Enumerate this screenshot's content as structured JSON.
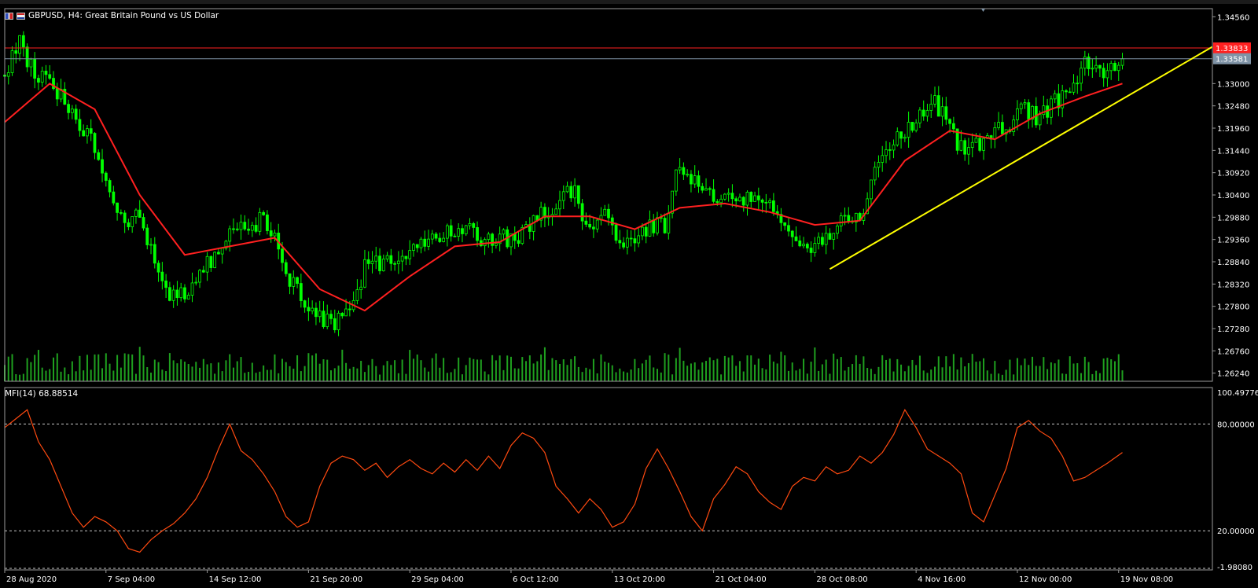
{
  "title": "GBPUSD, H4:  Great Britain Pound vs US Dollar",
  "price_axis": [
    "1.34560",
    "1.33000",
    "1.32480",
    "1.31960",
    "1.31440",
    "1.30920",
    "1.30400",
    "1.29880",
    "1.29360",
    "1.28840",
    "1.28320",
    "1.27800",
    "1.27280",
    "1.26760",
    "1.26240"
  ],
  "price_tags": {
    "red": "1.33833",
    "gray": "1.33581"
  },
  "mfi": {
    "label": "MFI(14) 68.88514",
    "axis": [
      "100.49776",
      "80.00000",
      "20.00000",
      "-1.98080"
    ]
  },
  "time_axis": [
    "28 Aug 2020",
    "7 Sep 04:00",
    "14 Sep 12:00",
    "21 Sep 20:00",
    "29 Sep 04:00",
    "6 Oct 12:00",
    "13 Oct 20:00",
    "21 Oct 04:00",
    "28 Oct 08:00",
    "4 Nov 16:00",
    "12 Nov 00:00",
    "19 Nov 08:00"
  ],
  "colors": {
    "background": "#000000",
    "candles": "#00ff00",
    "volumes": "#1fa01f",
    "ma": "#ff2020",
    "mfi": "#ff4a10",
    "trendline": "#ffff00",
    "red_level": "#ff2020",
    "gray_level": "#7f93a6"
  },
  "chart_data": [
    {
      "type": "candlestick",
      "symbol": "GBPUSD",
      "timeframe": "H4",
      "ylim": [
        1.2605,
        1.3475
      ],
      "close_path": [
        [
          0,
          1.332
        ],
        [
          4,
          1.339
        ],
        [
          8,
          1.333
        ],
        [
          12,
          1.33
        ],
        [
          16,
          1.326
        ],
        [
          20,
          1.321
        ],
        [
          24,
          1.315
        ],
        [
          28,
          1.305
        ],
        [
          32,
          1.297
        ],
        [
          36,
          1.3
        ],
        [
          40,
          1.287
        ],
        [
          44,
          1.28
        ],
        [
          48,
          1.281
        ],
        [
          52,
          1.287
        ],
        [
          56,
          1.29
        ],
        [
          60,
          1.294
        ],
        [
          64,
          1.296
        ],
        [
          68,
          1.298
        ],
        [
          72,
          1.295
        ],
        [
          76,
          1.284
        ],
        [
          80,
          1.279
        ],
        [
          84,
          1.275
        ],
        [
          88,
          1.274
        ],
        [
          92,
          1.276
        ],
        [
          96,
          1.287
        ],
        [
          100,
          1.288
        ],
        [
          104,
          1.289
        ],
        [
          108,
          1.29
        ],
        [
          112,
          1.292
        ],
        [
          116,
          1.294
        ],
        [
          120,
          1.296
        ],
        [
          124,
          1.298
        ],
        [
          128,
          1.292
        ],
        [
          132,
          1.295
        ],
        [
          136,
          1.293
        ],
        [
          140,
          1.297
        ],
        [
          144,
          1.3
        ],
        [
          148,
          1.303
        ],
        [
          152,
          1.305
        ],
        [
          156,
          1.295
        ],
        [
          160,
          1.3
        ],
        [
          164,
          1.293
        ],
        [
          168,
          1.295
        ],
        [
          172,
          1.296
        ],
        [
          176,
          1.297
        ],
        [
          180,
          1.312
        ],
        [
          184,
          1.307
        ],
        [
          188,
          1.304
        ],
        [
          192,
          1.303
        ],
        [
          196,
          1.302
        ],
        [
          200,
          1.304
        ],
        [
          204,
          1.302
        ],
        [
          208,
          1.298
        ],
        [
          212,
          1.291
        ],
        [
          216,
          1.292
        ],
        [
          220,
          1.295
        ],
        [
          224,
          1.3
        ],
        [
          228,
          1.297
        ],
        [
          232,
          1.311
        ],
        [
          236,
          1.315
        ],
        [
          240,
          1.318
        ],
        [
          244,
          1.322
        ],
        [
          248,
          1.325
        ],
        [
          252,
          1.32
        ],
        [
          256,
          1.313
        ],
        [
          260,
          1.316
        ],
        [
          264,
          1.319
        ],
        [
          268,
          1.321
        ],
        [
          272,
          1.324
        ],
        [
          276,
          1.322
        ],
        [
          280,
          1.326
        ],
        [
          284,
          1.328
        ],
        [
          288,
          1.335
        ],
        [
          292,
          1.332
        ],
        [
          296,
          1.334
        ],
        [
          298,
          1.3358
        ]
      ],
      "last_close": 1.33581,
      "levels": [
        1.33833,
        1.33581
      ]
    },
    {
      "type": "line",
      "indicator": "Moving Average",
      "x": [
        0,
        12,
        24,
        36,
        48,
        60,
        72,
        84,
        96,
        108,
        120,
        132,
        144,
        156,
        168,
        180,
        192,
        204,
        216,
        228,
        240,
        252,
        264,
        276,
        288,
        298
      ],
      "y": [
        1.321,
        1.33,
        1.324,
        1.304,
        1.29,
        1.292,
        1.294,
        1.282,
        1.277,
        1.285,
        1.292,
        1.293,
        1.299,
        1.299,
        1.296,
        1.301,
        1.302,
        1.3,
        1.297,
        1.298,
        1.312,
        1.319,
        1.317,
        1.323,
        1.327,
        1.33
      ]
    },
    {
      "type": "line",
      "indicator": "Trendline",
      "x": [
        220,
        322
      ],
      "y": [
        1.2867,
        1.3386
      ]
    },
    {
      "type": "line",
      "indicator": "MFI(14)",
      "current": 68.88514,
      "ylim": [
        -1.9808,
        100.49776
      ],
      "levels": [
        80,
        20
      ],
      "x": [
        0,
        3,
        6,
        9,
        12,
        15,
        18,
        21,
        24,
        27,
        30,
        33,
        36,
        39,
        42,
        45,
        48,
        51,
        54,
        57,
        60,
        63,
        66,
        69,
        72,
        75,
        78,
        81,
        84,
        87,
        90,
        93,
        96,
        99,
        102,
        105,
        108,
        111,
        114,
        117,
        120,
        123,
        126,
        129,
        132,
        135,
        138,
        141,
        144,
        147,
        150,
        153,
        156,
        159,
        162,
        165,
        168,
        171,
        174,
        177,
        180,
        183,
        186,
        189,
        192,
        195,
        198,
        201,
        204,
        207,
        210,
        213,
        216,
        219,
        222,
        225,
        228,
        231,
        234,
        237,
        240,
        243,
        246,
        249,
        252,
        255,
        258,
        261,
        264,
        267,
        270,
        273,
        276,
        279,
        282,
        285,
        288,
        291,
        294,
        298
      ],
      "y": [
        78,
        83,
        88,
        70,
        60,
        45,
        30,
        22,
        28,
        25,
        20,
        10,
        8,
        15,
        20,
        24,
        30,
        38,
        50,
        66,
        80,
        65,
        60,
        52,
        42,
        28,
        22,
        25,
        45,
        58,
        62,
        60,
        54,
        58,
        50,
        56,
        60,
        55,
        52,
        58,
        53,
        60,
        54,
        62,
        55,
        68,
        75,
        72,
        64,
        45,
        38,
        30,
        38,
        32,
        22,
        25,
        35,
        55,
        66,
        55,
        42,
        28,
        20,
        38,
        46,
        56,
        52,
        42,
        36,
        32,
        45,
        50,
        48,
        56,
        52,
        54,
        62,
        58,
        64,
        74,
        88,
        78,
        66,
        62,
        58,
        52,
        30,
        25,
        40,
        55,
        78,
        82,
        76,
        72,
        62,
        48,
        50,
        54,
        58,
        64
      ]
    }
  ]
}
